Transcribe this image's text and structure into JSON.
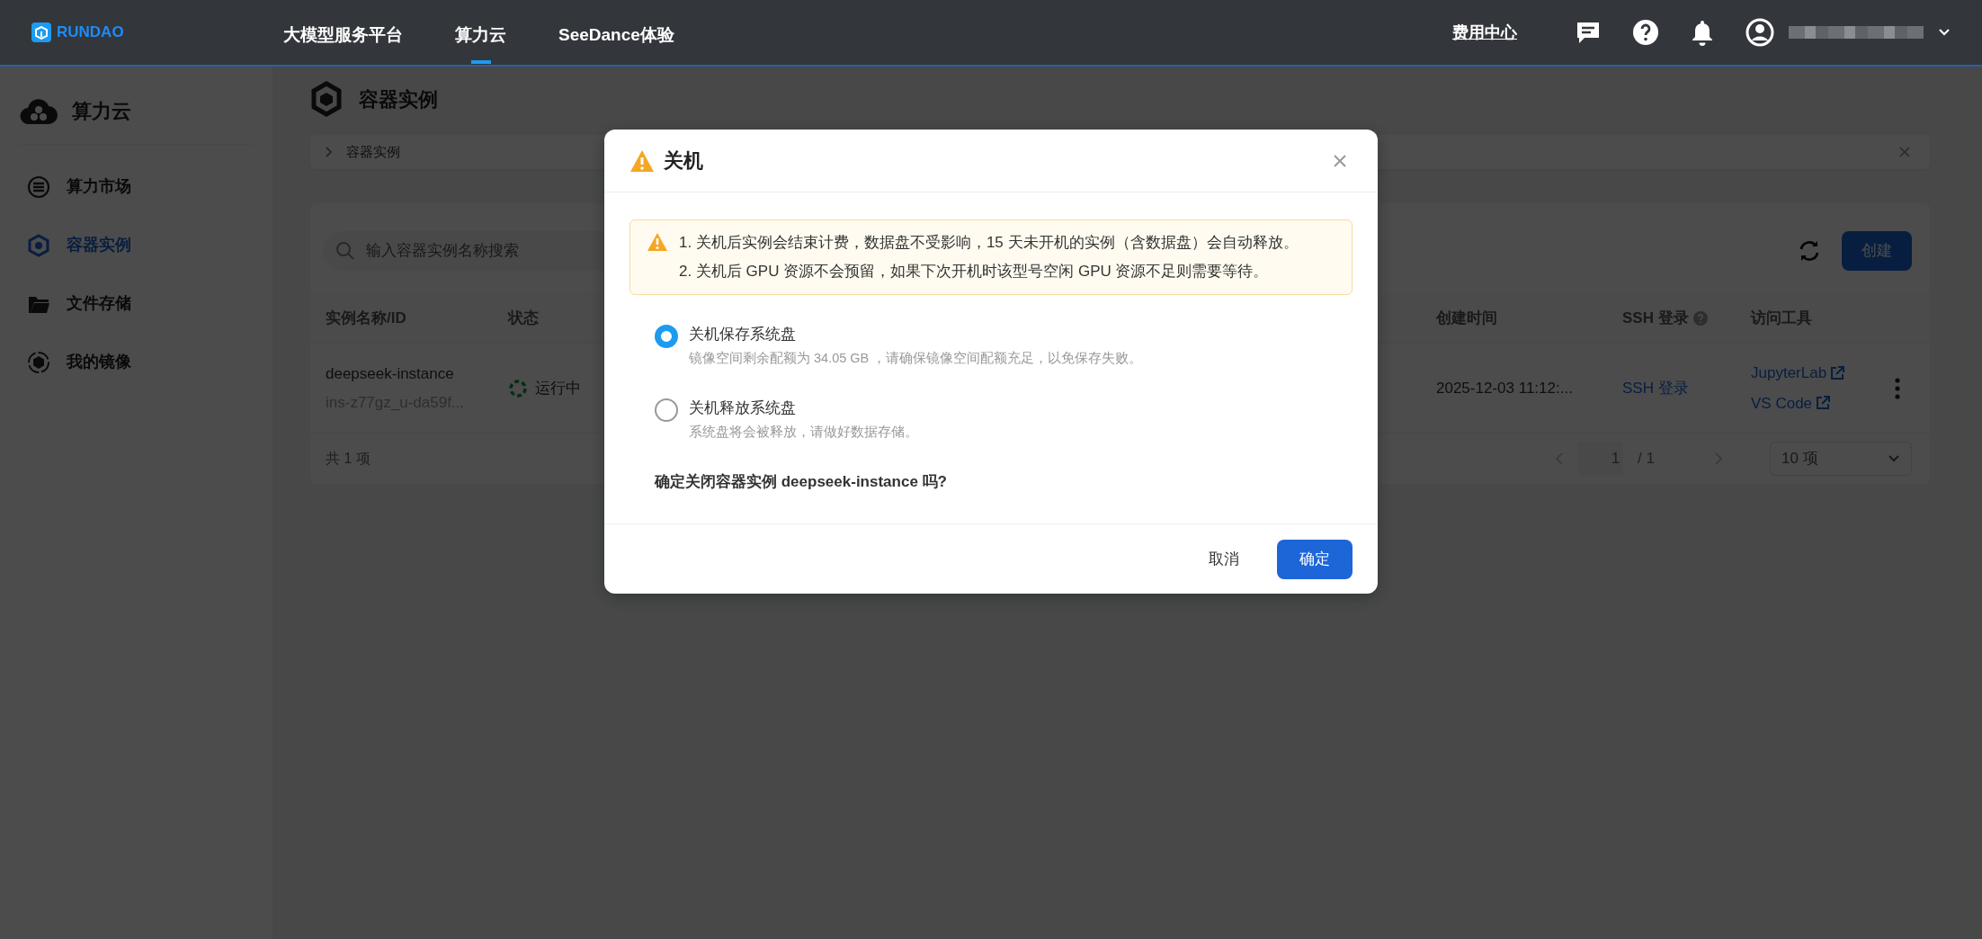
{
  "header": {
    "logo": "RUNDAO",
    "nav": [
      {
        "label": "大模型服务平台",
        "selected": false
      },
      {
        "label": "算力云",
        "selected": true
      },
      {
        "label": "SeeDance体验",
        "selected": false
      }
    ],
    "link": "费用中心"
  },
  "sidebar": {
    "title": "算力云",
    "items": [
      {
        "label": "算力市场",
        "selected": false
      },
      {
        "label": "容器实例",
        "selected": true
      },
      {
        "label": "文件存储",
        "selected": false
      },
      {
        "label": "我的镜像",
        "selected": false
      }
    ]
  },
  "page_title": "容器实例",
  "breadcrumb": [
    "容器实例"
  ],
  "toolbar": {
    "search": {
      "placeholder": "输入容器实例名称搜索"
    },
    "create_button": "创建"
  },
  "table": {
    "columns": [
      {
        "label": "实例名称/ID",
        "help": false
      },
      {
        "label": "状态",
        "help": false
      },
      {
        "label": "创建时间",
        "help": false
      },
      {
        "label": "SSH 登录",
        "help": true
      },
      {
        "label": "访问工具",
        "help": false
      }
    ],
    "rows": [
      {
        "name": "deepseek-instance",
        "id": "ins-z77gz_u-da59f...",
        "status": "运行中",
        "created": "2025-12-03 11:12:...",
        "ssh": "SSH 登录",
        "tools": [
          "JupyterLab",
          "VS Code"
        ]
      }
    ]
  },
  "pagination": {
    "total": "共 1 项",
    "page": "1",
    "pages": "/ 1",
    "page_size": "10 项"
  },
  "dialog": {
    "title": "关机",
    "notice": [
      "1. 关机后实例会结束计费，数据盘不受影响，15 天未开机的实例（含数据盘）会自动释放。",
      "2. 关机后 GPU 资源不会预留，如果下次开机时该型号空闲 GPU 资源不足则需要等待。"
    ],
    "options": [
      {
        "label": "关机保存系统盘",
        "description": "镜像空间剩余配额为 34.05 GB ，请确保镜像空间配额充足，以免保存失败。",
        "selected": true
      },
      {
        "label": "关机释放系统盘",
        "description": "系统盘将会被释放，请做好数据存储。",
        "selected": false
      }
    ],
    "question": "确定关闭容器实例 deepseek-instance 吗?",
    "cancel": "取消",
    "confirm": "确定"
  }
}
